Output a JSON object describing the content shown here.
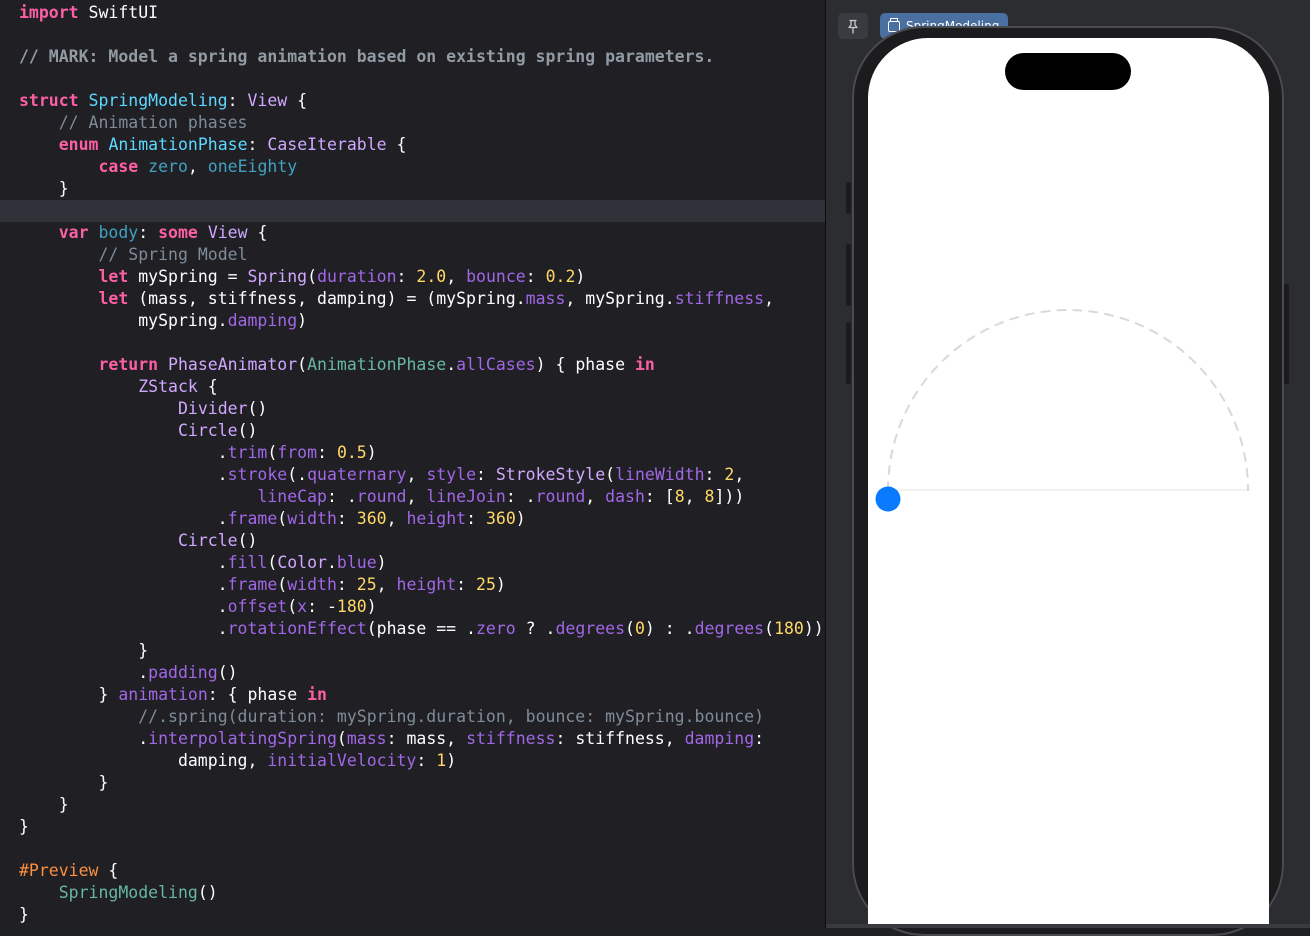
{
  "editor": {
    "lines": [
      [
        {
          "t": "import",
          "c": "kw"
        },
        {
          "t": " SwiftUI"
        }
      ],
      [],
      [
        {
          "t": "// MARK: Model a spring animation based on existing spring parameters.",
          "c": "mark"
        }
      ],
      [],
      [
        {
          "t": "struct",
          "c": "kw"
        },
        {
          "t": " "
        },
        {
          "t": "SpringModeling",
          "c": "ty"
        },
        {
          "t": ": "
        },
        {
          "t": "View",
          "c": "tyx"
        },
        {
          "t": " {"
        }
      ],
      [
        {
          "t": "    "
        },
        {
          "t": "// Animation phases",
          "c": "cm"
        }
      ],
      [
        {
          "t": "    "
        },
        {
          "t": "enum",
          "c": "kw"
        },
        {
          "t": " "
        },
        {
          "t": "AnimationPhase",
          "c": "ty"
        },
        {
          "t": ": "
        },
        {
          "t": "CaseIterable",
          "c": "tyx"
        },
        {
          "t": " {"
        }
      ],
      [
        {
          "t": "        "
        },
        {
          "t": "case",
          "c": "kw"
        },
        {
          "t": " "
        },
        {
          "t": "zero",
          "c": "dm"
        },
        {
          "t": ", "
        },
        {
          "t": "oneEighty",
          "c": "dm"
        }
      ],
      [
        {
          "t": "    }"
        }
      ],
      [],
      [
        {
          "t": "    "
        },
        {
          "t": "var",
          "c": "kw"
        },
        {
          "t": " "
        },
        {
          "t": "body",
          "c": "dm"
        },
        {
          "t": ": "
        },
        {
          "t": "some",
          "c": "kw"
        },
        {
          "t": " "
        },
        {
          "t": "View",
          "c": "tyx"
        },
        {
          "t": " {"
        }
      ],
      [
        {
          "t": "        "
        },
        {
          "t": "// Spring Model",
          "c": "cm"
        }
      ],
      [
        {
          "t": "        "
        },
        {
          "t": "let",
          "c": "kw"
        },
        {
          "t": " mySpring = "
        },
        {
          "t": "Spring",
          "c": "tyx"
        },
        {
          "t": "("
        },
        {
          "t": "duration",
          "c": "mem"
        },
        {
          "t": ": "
        },
        {
          "t": "2.0",
          "c": "num"
        },
        {
          "t": ", "
        },
        {
          "t": "bounce",
          "c": "mem"
        },
        {
          "t": ": "
        },
        {
          "t": "0.2",
          "c": "num"
        },
        {
          "t": ")"
        }
      ],
      [
        {
          "t": "        "
        },
        {
          "t": "let",
          "c": "kw"
        },
        {
          "t": " (mass, stiffness, damping) = (mySpring."
        },
        {
          "t": "mass",
          "c": "mem"
        },
        {
          "t": ", mySpring."
        },
        {
          "t": "stiffness",
          "c": "mem"
        },
        {
          "t": ","
        }
      ],
      [
        {
          "t": "            mySpring."
        },
        {
          "t": "damping",
          "c": "mem"
        },
        {
          "t": ")"
        }
      ],
      [],
      [
        {
          "t": "        "
        },
        {
          "t": "return",
          "c": "kw"
        },
        {
          "t": " "
        },
        {
          "t": "PhaseAnimator",
          "c": "tyx"
        },
        {
          "t": "("
        },
        {
          "t": "AnimationPhase",
          "c": "fn"
        },
        {
          "t": "."
        },
        {
          "t": "allCases",
          "c": "mem"
        },
        {
          "t": ") { phase "
        },
        {
          "t": "in",
          "c": "kw"
        }
      ],
      [
        {
          "t": "            "
        },
        {
          "t": "ZStack",
          "c": "tyx"
        },
        {
          "t": " {"
        }
      ],
      [
        {
          "t": "                "
        },
        {
          "t": "Divider",
          "c": "tyx"
        },
        {
          "t": "()"
        }
      ],
      [
        {
          "t": "                "
        },
        {
          "t": "Circle",
          "c": "tyx"
        },
        {
          "t": "()"
        }
      ],
      [
        {
          "t": "                    ."
        },
        {
          "t": "trim",
          "c": "mem"
        },
        {
          "t": "("
        },
        {
          "t": "from",
          "c": "mem"
        },
        {
          "t": ": "
        },
        {
          "t": "0.5",
          "c": "num"
        },
        {
          "t": ")"
        }
      ],
      [
        {
          "t": "                    ."
        },
        {
          "t": "stroke",
          "c": "mem"
        },
        {
          "t": "(."
        },
        {
          "t": "quaternary",
          "c": "mem"
        },
        {
          "t": ", "
        },
        {
          "t": "style",
          "c": "mem"
        },
        {
          "t": ": "
        },
        {
          "t": "StrokeStyle",
          "c": "tyx"
        },
        {
          "t": "("
        },
        {
          "t": "lineWidth",
          "c": "mem"
        },
        {
          "t": ": "
        },
        {
          "t": "2",
          "c": "num"
        },
        {
          "t": ","
        }
      ],
      [
        {
          "t": "                        "
        },
        {
          "t": "lineCap",
          "c": "mem"
        },
        {
          "t": ": ."
        },
        {
          "t": "round",
          "c": "mem"
        },
        {
          "t": ", "
        },
        {
          "t": "lineJoin",
          "c": "mem"
        },
        {
          "t": ": ."
        },
        {
          "t": "round",
          "c": "mem"
        },
        {
          "t": ", "
        },
        {
          "t": "dash",
          "c": "mem"
        },
        {
          "t": ": ["
        },
        {
          "t": "8",
          "c": "num"
        },
        {
          "t": ", "
        },
        {
          "t": "8",
          "c": "num"
        },
        {
          "t": "]))"
        }
      ],
      [
        {
          "t": "                    ."
        },
        {
          "t": "frame",
          "c": "mem"
        },
        {
          "t": "("
        },
        {
          "t": "width",
          "c": "mem"
        },
        {
          "t": ": "
        },
        {
          "t": "360",
          "c": "num"
        },
        {
          "t": ", "
        },
        {
          "t": "height",
          "c": "mem"
        },
        {
          "t": ": "
        },
        {
          "t": "360",
          "c": "num"
        },
        {
          "t": ")"
        }
      ],
      [
        {
          "t": "                "
        },
        {
          "t": "Circle",
          "c": "tyx"
        },
        {
          "t": "()"
        }
      ],
      [
        {
          "t": "                    ."
        },
        {
          "t": "fill",
          "c": "mem"
        },
        {
          "t": "("
        },
        {
          "t": "Color",
          "c": "tyx"
        },
        {
          "t": "."
        },
        {
          "t": "blue",
          "c": "mem"
        },
        {
          "t": ")"
        }
      ],
      [
        {
          "t": "                    ."
        },
        {
          "t": "frame",
          "c": "mem"
        },
        {
          "t": "("
        },
        {
          "t": "width",
          "c": "mem"
        },
        {
          "t": ": "
        },
        {
          "t": "25",
          "c": "num"
        },
        {
          "t": ", "
        },
        {
          "t": "height",
          "c": "mem"
        },
        {
          "t": ": "
        },
        {
          "t": "25",
          "c": "num"
        },
        {
          "t": ")"
        }
      ],
      [
        {
          "t": "                    ."
        },
        {
          "t": "offset",
          "c": "mem"
        },
        {
          "t": "("
        },
        {
          "t": "x",
          "c": "mem"
        },
        {
          "t": ": -"
        },
        {
          "t": "180",
          "c": "num"
        },
        {
          "t": ")"
        }
      ],
      [
        {
          "t": "                    ."
        },
        {
          "t": "rotationEffect",
          "c": "mem"
        },
        {
          "t": "(phase == ."
        },
        {
          "t": "zero",
          "c": "mem"
        },
        {
          "t": " ? ."
        },
        {
          "t": "degrees",
          "c": "mem"
        },
        {
          "t": "("
        },
        {
          "t": "0",
          "c": "num"
        },
        {
          "t": ") : ."
        },
        {
          "t": "degrees",
          "c": "mem"
        },
        {
          "t": "("
        },
        {
          "t": "180",
          "c": "num"
        },
        {
          "t": "))"
        }
      ],
      [
        {
          "t": "            }"
        }
      ],
      [
        {
          "t": "            ."
        },
        {
          "t": "padding",
          "c": "mem"
        },
        {
          "t": "()"
        }
      ],
      [
        {
          "t": "        } "
        },
        {
          "t": "animation",
          "c": "mem"
        },
        {
          "t": ": { phase "
        },
        {
          "t": "in",
          "c": "kw"
        }
      ],
      [
        {
          "t": "            "
        },
        {
          "t": "//.spring(duration: mySpring.duration, bounce: mySpring.bounce)",
          "c": "cm"
        }
      ],
      [
        {
          "t": "            ."
        },
        {
          "t": "interpolatingSpring",
          "c": "mem"
        },
        {
          "t": "("
        },
        {
          "t": "mass",
          "c": "mem"
        },
        {
          "t": ": mass, "
        },
        {
          "t": "stiffness",
          "c": "mem"
        },
        {
          "t": ": stiffness, "
        },
        {
          "t": "damping",
          "c": "mem"
        },
        {
          "t": ":"
        }
      ],
      [
        {
          "t": "                damping, "
        },
        {
          "t": "initialVelocity",
          "c": "mem"
        },
        {
          "t": ": "
        },
        {
          "t": "1",
          "c": "num"
        },
        {
          "t": ")"
        }
      ],
      [
        {
          "t": "        }"
        }
      ],
      [
        {
          "t": "    }"
        }
      ],
      [
        {
          "t": "}"
        }
      ],
      [],
      [
        {
          "t": "#Preview",
          "c": "pp"
        },
        {
          "t": " {"
        }
      ],
      [
        {
          "t": "    "
        },
        {
          "t": "SpringModeling",
          "c": "fn"
        },
        {
          "t": "()"
        }
      ],
      [
        {
          "t": "}"
        }
      ]
    ]
  },
  "preview": {
    "tab_label": "SpringModeling",
    "pin_icon": "pin-icon",
    "tab_icon": "preview-window-icon",
    "accent": "#0a7aff",
    "arc_color": "#d9d9dc",
    "divider_color": "#e3e3e6"
  }
}
